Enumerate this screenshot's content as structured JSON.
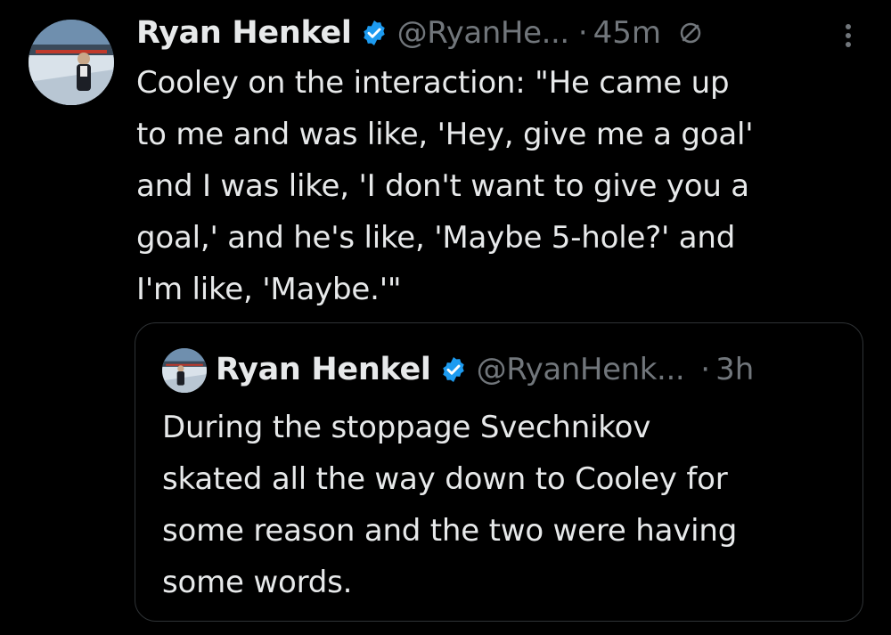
{
  "tweet": {
    "author": {
      "name": "Ryan Henkel",
      "handle": "@RyanHe...",
      "avatar": "rink-photo-avatar",
      "verified": true
    },
    "separator": "·",
    "time": "45m",
    "edited_icon": "edit-history-icon",
    "more_icon": "more-options-icon",
    "text_lines": [
      "Cooley on the interaction: \"He came up",
      "to me and was like, 'Hey, give me a goal'",
      "and I was like, 'I don't want to give you a",
      "goal,' and he's like, 'Maybe 5-hole?' and",
      "I'm like, 'Maybe.'\""
    ]
  },
  "quoted_tweet": {
    "author": {
      "name": "Ryan Henkel",
      "handle": "@RyanHenk...",
      "avatar": "rink-photo-avatar",
      "verified": true
    },
    "separator": "·",
    "time": "3h",
    "text_lines": [
      "During the stoppage Svechnikov",
      "skated all the way down to Cooley for",
      "some reason and the two were having",
      "some words."
    ]
  },
  "colors": {
    "background": "#000000",
    "text": "#e7e9ea",
    "secondary": "#71767b",
    "verified_blue": "#1d9bf0",
    "border": "#2f3336"
  }
}
